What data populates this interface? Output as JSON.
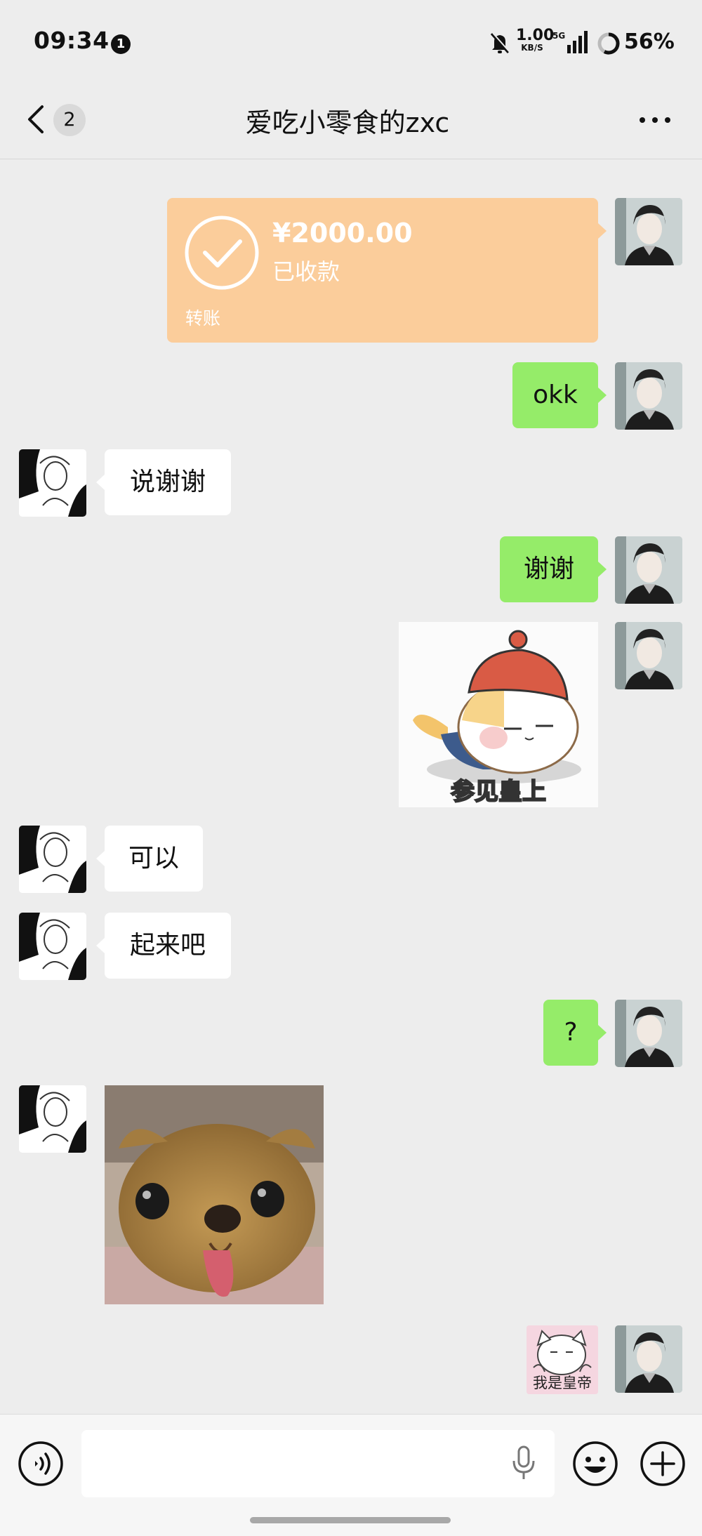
{
  "status_bar": {
    "time": "09:34",
    "notification_count": "1",
    "net_speed": "1.00",
    "net_unit": "KB/S",
    "network": "5G",
    "battery": "56%"
  },
  "header": {
    "unread_count": "2",
    "title": "爱吃小零食的zxc"
  },
  "messages": {
    "transfer": {
      "amount": "¥2000.00",
      "status": "已收款",
      "label": "转账"
    },
    "m_okk": "okk",
    "m_say_thanks": "说谢谢",
    "m_thanks": "谢谢",
    "sticker_1_caption": "参见皇上",
    "m_can": "可以",
    "m_rise": "起来吧",
    "m_question": "?",
    "sticker_2_caption": "我是皇帝"
  },
  "colors": {
    "sent_bubble": "#95ec69",
    "received_bubble": "#ffffff",
    "transfer_card": "#fbcd9b",
    "background": "#ededed"
  },
  "icons": [
    "back-chevron-icon",
    "more-dots-icon",
    "voice-icon",
    "mic-icon",
    "emoji-icon",
    "plus-icon"
  ]
}
